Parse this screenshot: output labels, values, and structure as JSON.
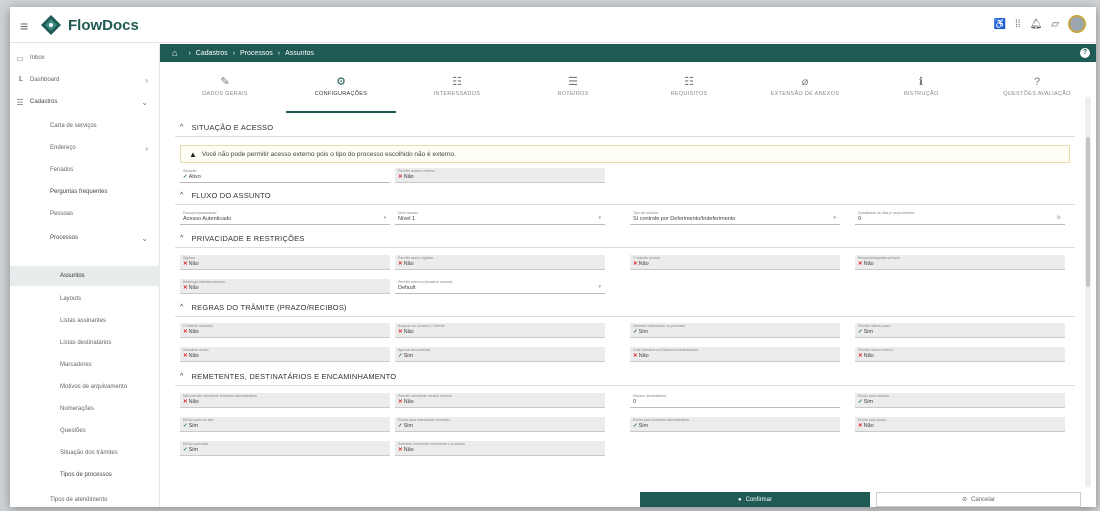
{
  "app": {
    "name": "FlowDocs"
  },
  "sidebar": {
    "items": [
      {
        "label": "Inbox",
        "icon": "inbox-icon"
      },
      {
        "label": "Dashboard",
        "icon": "chart-icon"
      },
      {
        "label": "Cadastros",
        "icon": "list-icon"
      },
      {
        "label": "Carta de serviços"
      },
      {
        "label": "Endereço"
      },
      {
        "label": "Feriados"
      },
      {
        "label": "Perguntas frequentes"
      },
      {
        "label": "Pessoas"
      },
      {
        "label": "Processos"
      },
      {
        "label": "Assuntos"
      },
      {
        "label": "Layouts"
      },
      {
        "label": "Listas assinantes"
      },
      {
        "label": "Listas destinatários"
      },
      {
        "label": "Marcadores"
      },
      {
        "label": "Motivos de arquivamento"
      },
      {
        "label": "Numerações"
      },
      {
        "label": "Questões"
      },
      {
        "label": "Situação dos trâmites"
      },
      {
        "label": "Tipos de processos"
      },
      {
        "label": "Tipos de atendimento"
      }
    ]
  },
  "breadcrumb": {
    "items": [
      "Cadastros",
      "Processos",
      "Assuntos"
    ]
  },
  "tabs": [
    {
      "label": "DADOS GERAIS",
      "icon": "edit-icon"
    },
    {
      "label": "CONFIGURAÇÕES",
      "icon": "gears-icon"
    },
    {
      "label": "INTERESSADOS",
      "icon": "users-icon"
    },
    {
      "label": "ROTEIROS",
      "icon": "list-icon"
    },
    {
      "label": "REQUISITOS",
      "icon": "checklist-icon"
    },
    {
      "label": "EXTENSÃO DE ANEXOS",
      "icon": "paperclip-icon"
    },
    {
      "label": "INSTRUÇÃO",
      "icon": "info-icon"
    },
    {
      "label": "QUESTÕES AVALIAÇÃO",
      "icon": "question-icon"
    }
  ],
  "sections": {
    "s1": "SITUAÇÃO E ACESSO",
    "s2": "FLUXO DO ASSUNTO",
    "s3": "PRIVACIDADE E RESTRIÇÕES",
    "s4": "REGRAS DO TRÂMITE (PRAZO/RECIBOS)",
    "s5": "REMETENTES, DESTINATÁRIOS E ENCAMINHAMENTO"
  },
  "alert": {
    "text": "Você não pode permitir acesso externo pois o tipo do processo escolhido não é externo."
  },
  "fields": {
    "situacao": {
      "label": "Situação",
      "value": "Ativo"
    },
    "acesso_externo": {
      "label": "Permitir acesso externo",
      "value": "Não"
    },
    "fluxo_processamento": {
      "label": "Fluxo/processamento",
      "value": "Acesso Autenticado"
    },
    "nivel_acesso": {
      "label": "Nível acesso",
      "value": "Nível 1"
    },
    "tipo_controle": {
      "label": "Tipo de controle",
      "value": "Sí controle por Deferimento/Indeferimento"
    },
    "qtd_dias": {
      "label": "Quantidade de dias p/ arquivamento",
      "value": "0"
    },
    "sigiloso": {
      "label": "Sigiloso",
      "value": "Não"
    },
    "anexo_sigiloso": {
      "label": "Permitir anexo sigiloso",
      "value": "Não"
    },
    "tramite_privado": {
      "label": "1º trâmite privado",
      "value": "Não"
    },
    "resposta_privado": {
      "label": "Resposta/resposta privado",
      "value": "Não"
    },
    "restringir_tramites": {
      "label": "Restringir trâmites internos",
      "value": "Não"
    },
    "permitir_anexos": {
      "label": "Permitir anexos (visualizar anexos)",
      "value": "Default"
    },
    "tramite_assinado": {
      "label": "1º trâmite assinado",
      "value": "Não"
    },
    "arquivar_1_tramite": {
      "label": "Arquivar ao concluir 1º trâmite",
      "value": "Não"
    },
    "informar_interessado": {
      "label": "Informar interessado no processo",
      "value": "Sim"
    },
    "permitir_prazo": {
      "label": "Permitir alterar prazo",
      "value": "Sim"
    },
    "visualizar_recibo": {
      "label": "Visualizar recibo",
      "value": "Não"
    },
    "aprovar_documentos": {
      "label": "Aprovar documentos",
      "value": "Sim"
    },
    "criar_estrutura": {
      "label": "Criar estrutura na Estrutura Administrativa",
      "value": "Não"
    },
    "permitir_anexo_externo": {
      "label": "Permitir anexo externo",
      "value": "Não"
    },
    "nao_permitir_remetente": {
      "label": "Não permitir remetente Estrutura Administrativa",
      "value": "Não"
    },
    "permitir_remetente_externo": {
      "label": "Permitir remetente usuário externo",
      "value": "Não"
    },
    "maximo_destinatarios": {
      "label": "Máximo destinatários",
      "value": "0"
    },
    "enviar_cidadao": {
      "label": "Enviar para cidadão",
      "value": "Sim"
    },
    "enviar_lote": {
      "label": "Enviar para um lote",
      "value": "Sim"
    },
    "enviar_interessado": {
      "label": "Enviar para interessado remetido",
      "value": "Sim"
    },
    "enviar_estrutura": {
      "label": "Enviar para Estrutura Administrativa",
      "value": "Sim"
    },
    "enviar_grupo": {
      "label": "Enviar para grupo",
      "value": "Não"
    },
    "enviar_grupo_lote": {
      "label": "Enviar para lista",
      "value": "Sim"
    },
    "somente_remetente": {
      "label": "Somente remetente movimenta o processo",
      "value": "Não"
    }
  },
  "footer": {
    "confirm": "Confirmar",
    "cancel": "Cancelar"
  },
  "colors": {
    "brand": "#1f5a54",
    "danger": "#d22222",
    "success": "#2a7a3a"
  }
}
